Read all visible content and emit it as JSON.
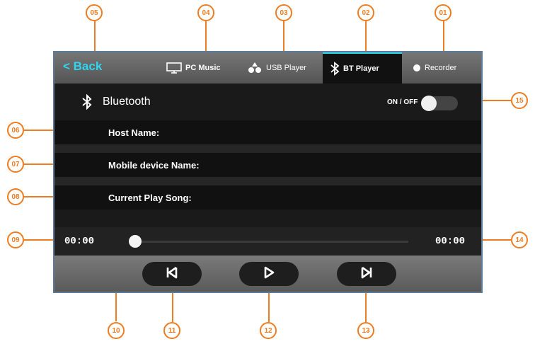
{
  "header": {
    "back_label": "< Back",
    "tabs": [
      {
        "label": "PC Music",
        "icon": "monitor-icon"
      },
      {
        "label": "USB Player",
        "icon": "usb-icon"
      },
      {
        "label": "BT Player",
        "icon": "bluetooth-icon",
        "active": true
      },
      {
        "label": "Recorder",
        "icon": "record-dot-icon"
      }
    ]
  },
  "bluetooth": {
    "title": "Bluetooth",
    "toggle_label": "ON / OFF",
    "toggle_state": "off"
  },
  "info": {
    "host_name_label": "Host Name:",
    "mobile_device_label": "Mobile device Name:",
    "current_song_label": "Current Play Song:"
  },
  "player": {
    "elapsed": "00:00",
    "total": "00:00",
    "progress": 0
  },
  "callouts": [
    "01",
    "02",
    "03",
    "04",
    "05",
    "06",
    "07",
    "08",
    "09",
    "10",
    "11",
    "12",
    "13",
    "14",
    "15"
  ],
  "colors": {
    "accent": "#2ed6f0",
    "callout": "#ee7d22",
    "frame": "#5c7d9a"
  }
}
